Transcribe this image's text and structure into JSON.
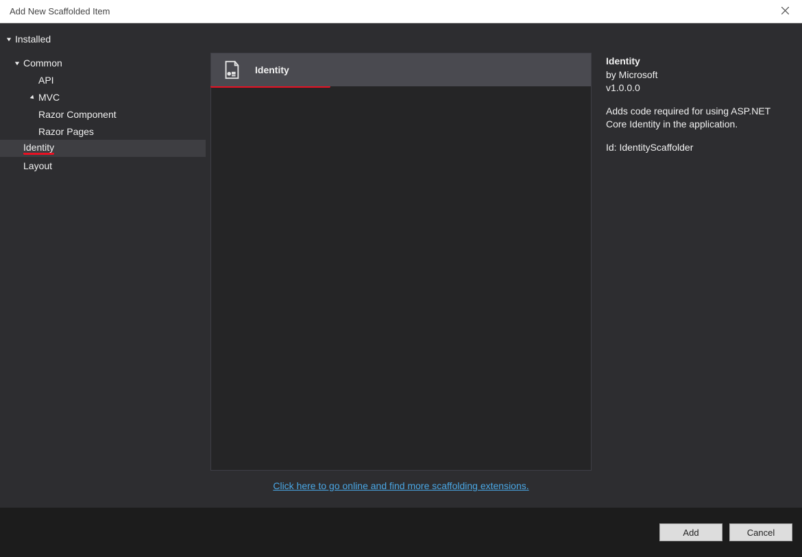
{
  "title": "Add New Scaffolded Item",
  "tree": {
    "installed": "Installed",
    "common": "Common",
    "api": "API",
    "mvc": "MVC",
    "razor_component": "Razor Component",
    "razor_pages": "Razor Pages",
    "identity": "Identity",
    "layout": "Layout"
  },
  "templates": {
    "identity": "Identity"
  },
  "detail": {
    "title": "Identity",
    "author": "by Microsoft",
    "version": "v1.0.0.0",
    "description": "Adds code required for using ASP.NET Core Identity in the application.",
    "id_line": "Id: IdentityScaffolder"
  },
  "online_link": "Click here to go online and find more scaffolding extensions.",
  "buttons": {
    "add": "Add",
    "cancel": "Cancel"
  }
}
